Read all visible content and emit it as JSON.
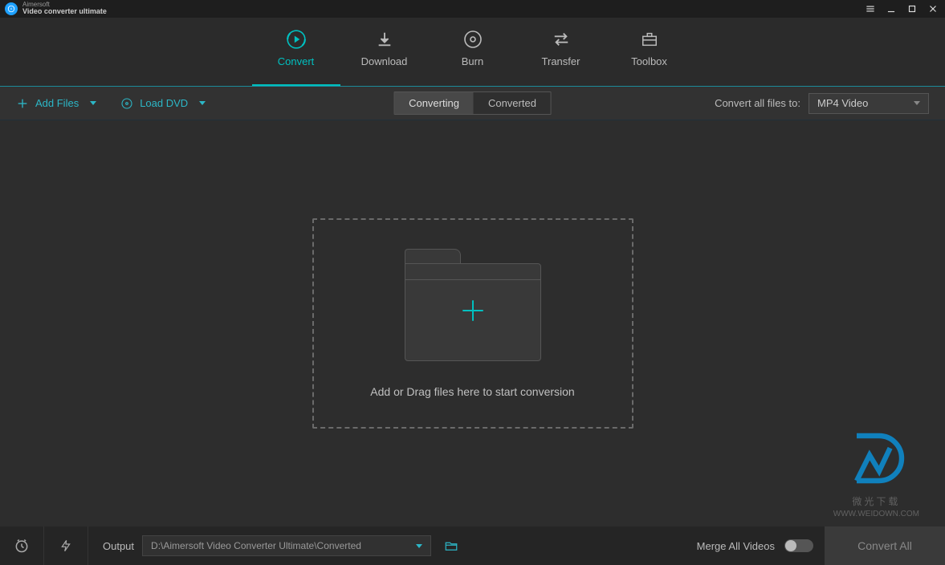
{
  "brand": {
    "line1": "Aimersoft",
    "line2": "Video converter ultimate"
  },
  "tabs": [
    {
      "label": "Convert",
      "icon": "convert-icon",
      "active": true
    },
    {
      "label": "Download",
      "icon": "download-icon",
      "active": false
    },
    {
      "label": "Burn",
      "icon": "burn-icon",
      "active": false
    },
    {
      "label": "Transfer",
      "icon": "transfer-icon",
      "active": false
    },
    {
      "label": "Toolbox",
      "icon": "toolbox-icon",
      "active": false
    }
  ],
  "toolbar": {
    "add_files": "Add Files",
    "load_dvd": "Load DVD",
    "seg_converting": "Converting",
    "seg_converted": "Converted",
    "convert_all_label": "Convert all files to:",
    "format_selected": "MP4 Video"
  },
  "dropzone": {
    "text": "Add or Drag files here to start conversion"
  },
  "bottom": {
    "output_label": "Output",
    "output_path": "D:\\Aimersoft Video Converter Ultimate\\Converted",
    "merge_label": "Merge All Videos",
    "merge_on": false,
    "convert_all_btn": "Convert All"
  },
  "watermark": {
    "line1": "微光下载",
    "line2": "WWW.WEIDOWN.COM"
  }
}
